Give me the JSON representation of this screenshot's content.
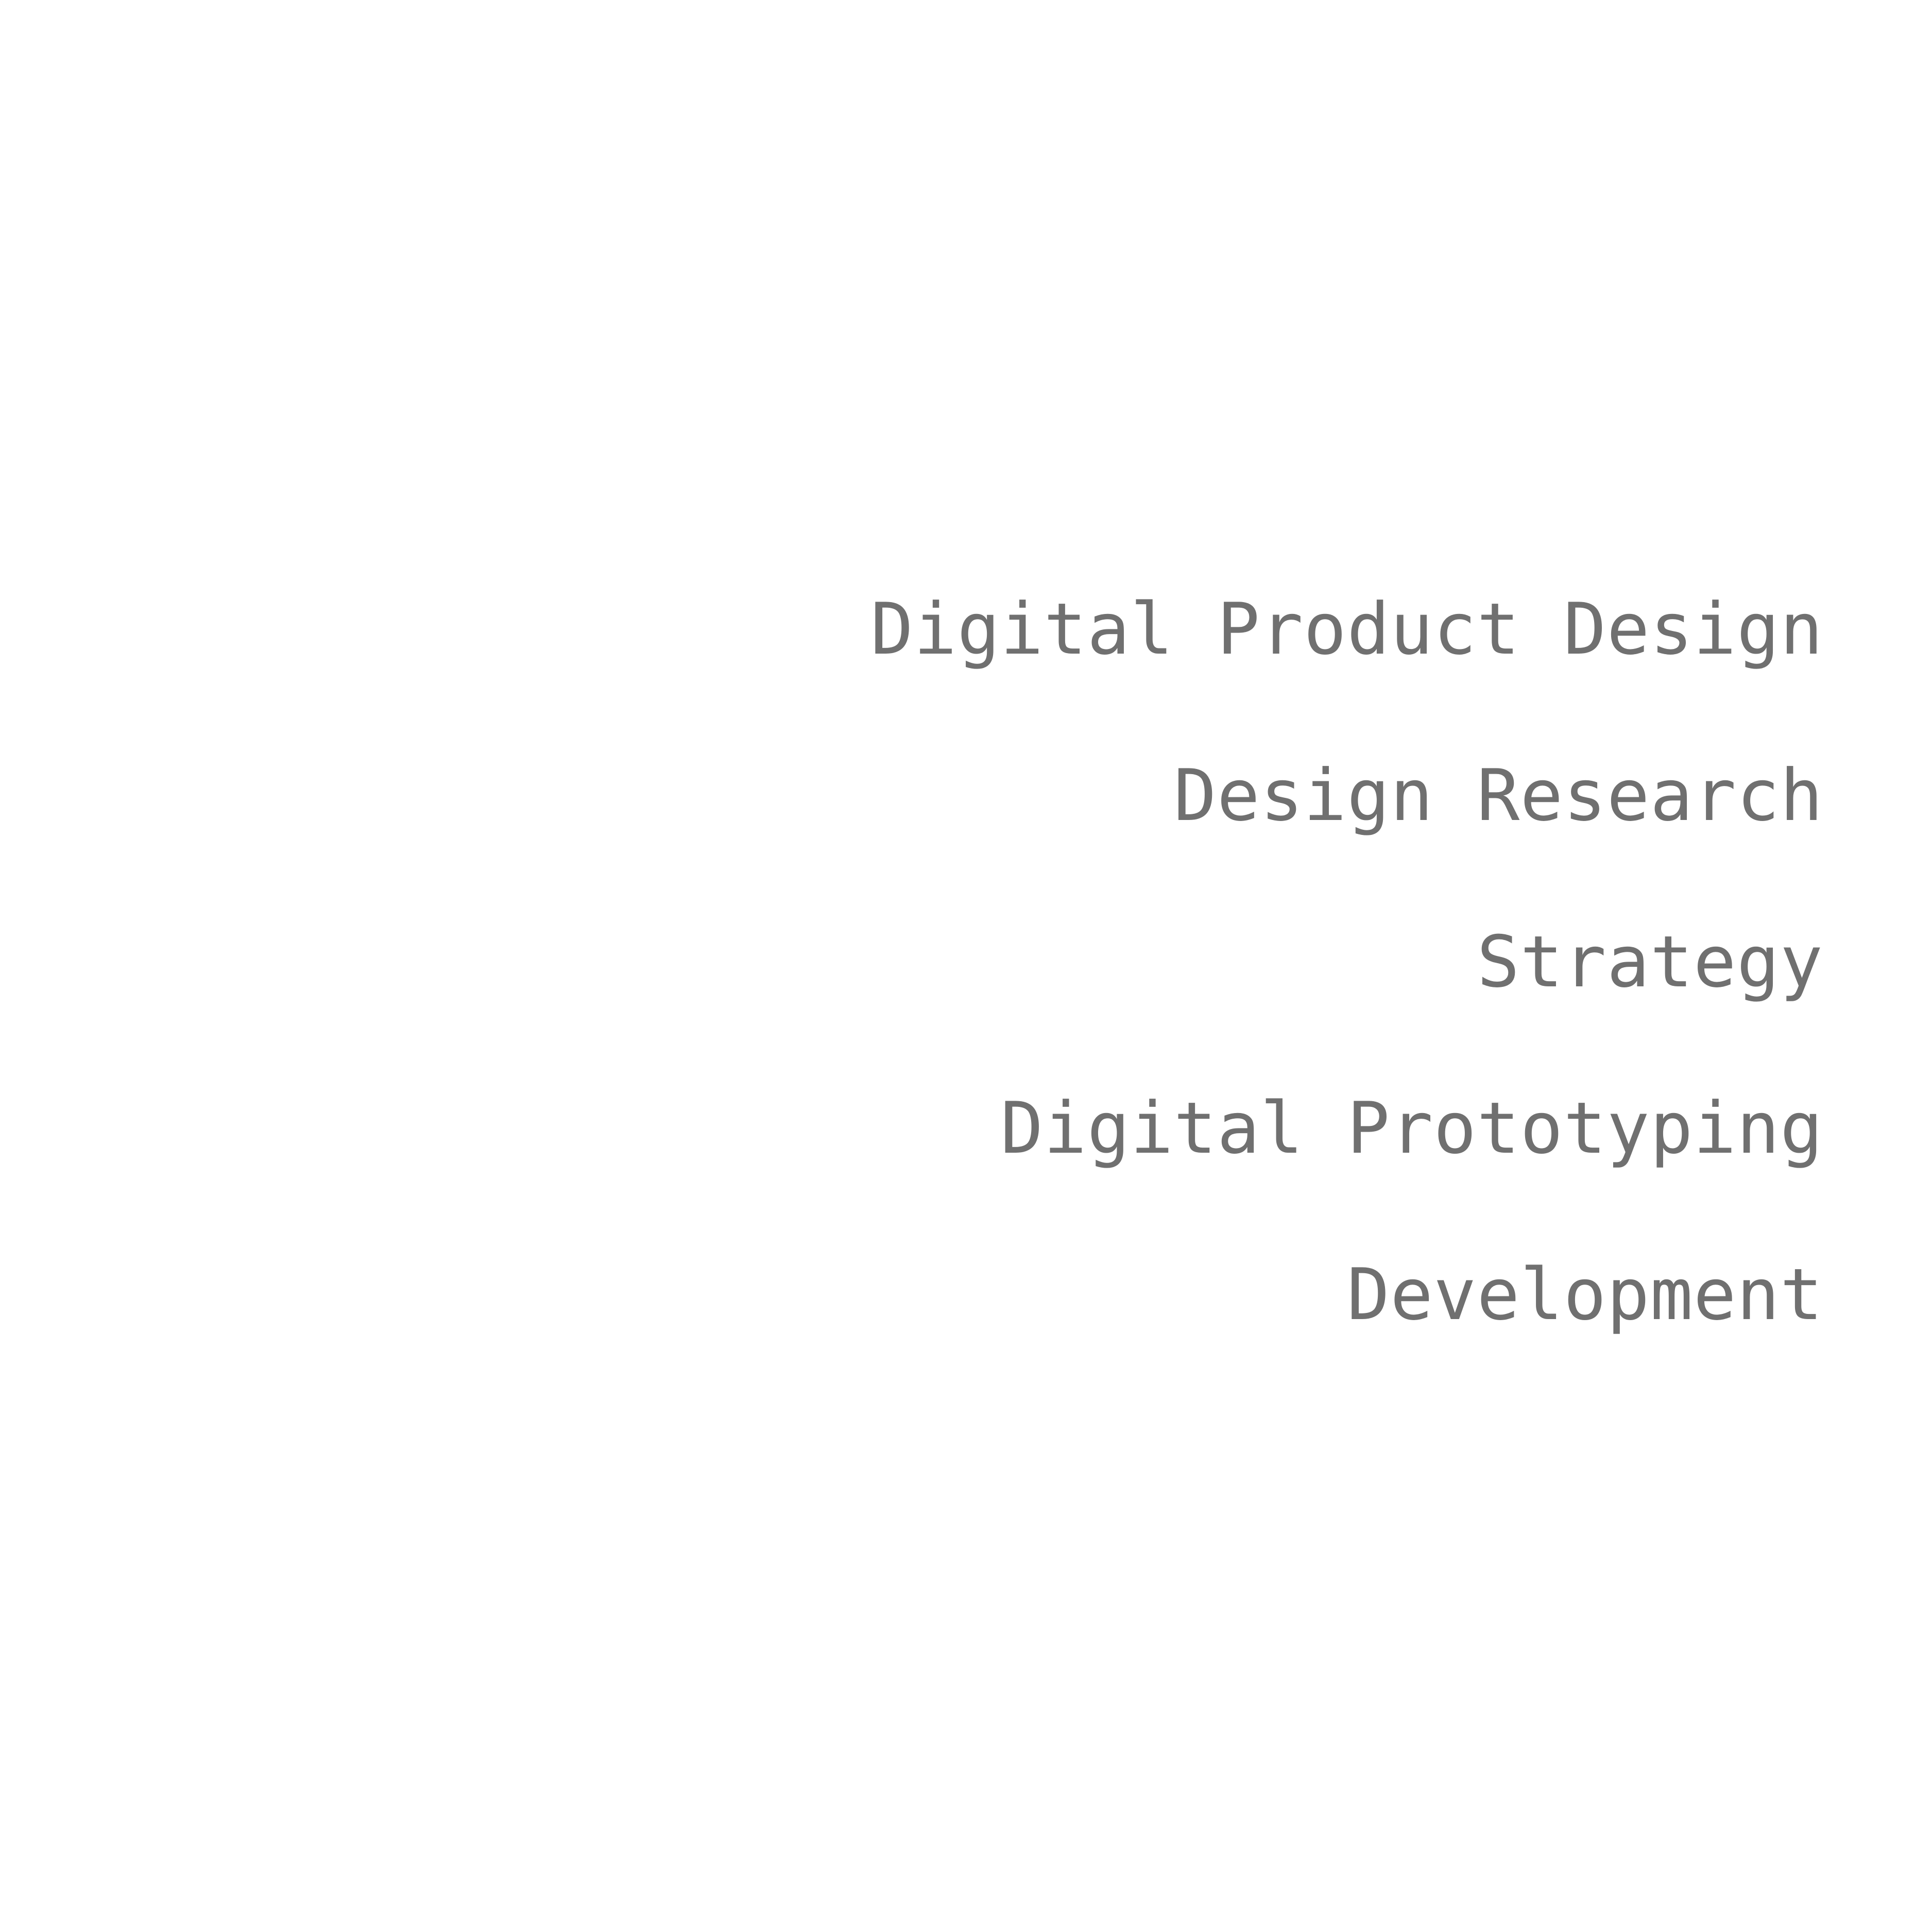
{
  "colors": {
    "background": "#ffffff",
    "text": "#707070"
  },
  "services": {
    "items": [
      {
        "label": "Digital Product Design"
      },
      {
        "label": "Design Research"
      },
      {
        "label": "Strategy"
      },
      {
        "label": "Digital Prototyping"
      },
      {
        "label": "Development"
      }
    ]
  }
}
